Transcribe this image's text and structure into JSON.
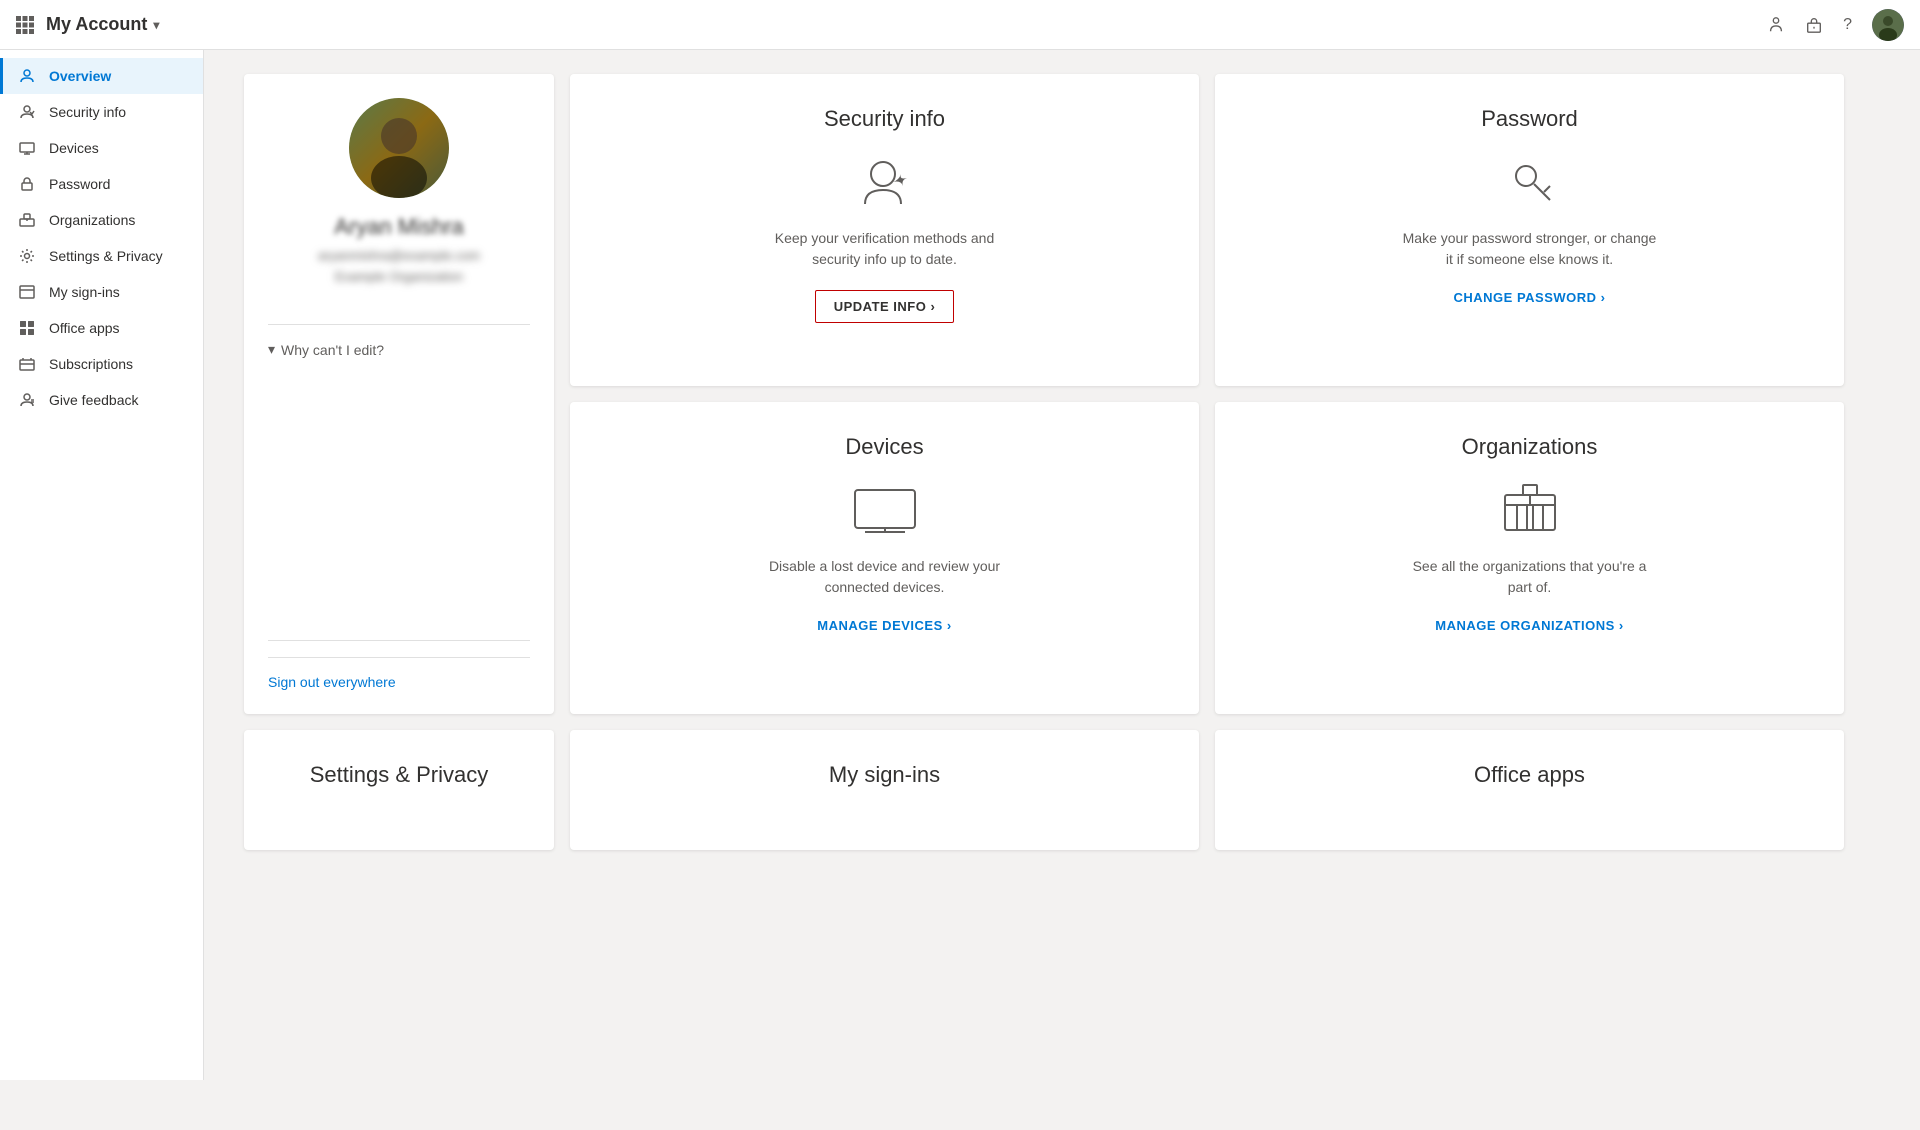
{
  "header": {
    "waffle_label": "⊞",
    "title": "My Account",
    "title_chevron": "▾",
    "icons": {
      "feedback": "💬",
      "org": "🏢",
      "help": "?"
    }
  },
  "sidebar": {
    "items": [
      {
        "id": "overview",
        "label": "Overview",
        "icon": "person",
        "active": true
      },
      {
        "id": "security-info",
        "label": "Security info",
        "icon": "shield"
      },
      {
        "id": "devices",
        "label": "Devices",
        "icon": "laptop"
      },
      {
        "id": "password",
        "label": "Password",
        "icon": "lock"
      },
      {
        "id": "organizations",
        "label": "Organizations",
        "icon": "building"
      },
      {
        "id": "settings-privacy",
        "label": "Settings & Privacy",
        "icon": "gear"
      },
      {
        "id": "my-sign-ins",
        "label": "My sign-ins",
        "icon": "signout"
      },
      {
        "id": "office-apps",
        "label": "Office apps",
        "icon": "grid"
      },
      {
        "id": "subscriptions",
        "label": "Subscriptions",
        "icon": "card"
      },
      {
        "id": "give-feedback",
        "label": "Give feedback",
        "icon": "feedback"
      }
    ]
  },
  "profile": {
    "name": "Aryan Mishra",
    "email": "aryanmishra@example.com",
    "org": "Example Organization",
    "why_edit_label": "Why can't I edit?",
    "sign_out_label": "Sign out everywhere"
  },
  "cards": {
    "security_info": {
      "title": "Security info",
      "description": "Keep your verification methods and security info up to date.",
      "action_label": "UPDATE INFO ›"
    },
    "password": {
      "title": "Password",
      "description": "Make your password stronger, or change it if someone else knows it.",
      "action_label": "CHANGE PASSWORD ›"
    },
    "devices": {
      "title": "Devices",
      "description": "Disable a lost device and review your connected devices.",
      "action_label": "MANAGE DEVICES ›"
    },
    "organizations": {
      "title": "Organizations",
      "description": "See all the organizations that you're a part of.",
      "action_label": "MANAGE ORGANIZATIONS ›"
    }
  },
  "bottom_cards": {
    "settings_privacy": {
      "title": "Settings & Privacy"
    },
    "my_sign_ins": {
      "title": "My sign-ins"
    },
    "office_apps": {
      "title": "Office apps"
    }
  },
  "colors": {
    "accent": "#0078d4",
    "sidebar_active_bg": "#e8f4fc",
    "sidebar_active_border": "#0078d4",
    "update_info_border": "#c00000",
    "divider": "#e0e0e0",
    "text_primary": "#323130",
    "text_secondary": "#605e5c"
  }
}
